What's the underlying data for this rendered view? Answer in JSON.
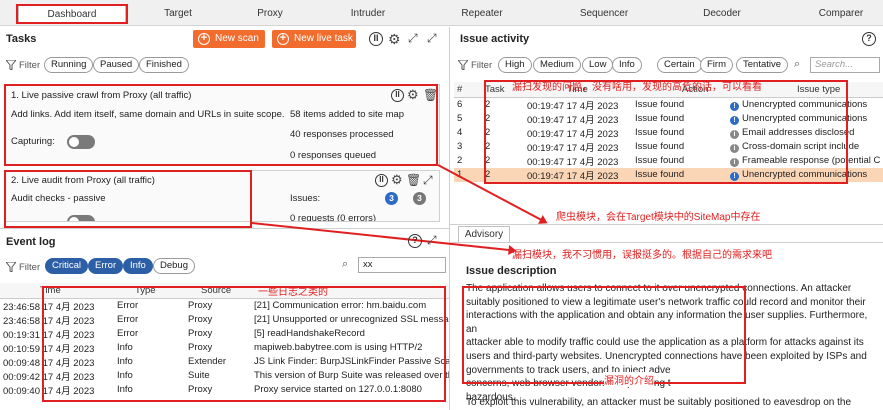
{
  "tabs": [
    "Dashboard",
    "Target",
    "Proxy",
    "Intruder",
    "Repeater",
    "Sequencer",
    "Decoder",
    "Comparer"
  ],
  "tasks": {
    "title": "Tasks",
    "new_scan": "New scan",
    "new_live_task": "New live task",
    "filter_label": "Filter",
    "filters": [
      "Running",
      "Paused",
      "Finished"
    ],
    "task1": {
      "title": "1. Live passive crawl from Proxy (all traffic)",
      "description": "Add links. Add item itself, same domain and URLs in suite scope.",
      "capturing_label": "Capturing:",
      "stat1": "58 items added to site map",
      "stat2": "40 responses processed",
      "stat3": "0 responses queued"
    },
    "task2": {
      "title": "2. Live audit from Proxy (all traffic)",
      "description": "Audit checks - passive",
      "issues_label": "Issues:",
      "issue_count_blue": "3",
      "issue_count_grey": "3",
      "requests": "0 requests (0 errors)"
    }
  },
  "issue_activity": {
    "title": "Issue activity",
    "filter_label": "Filter",
    "severity_filters": [
      "High",
      "Medium",
      "Low",
      "Info"
    ],
    "confidence_filters": [
      "Certain",
      "Firm",
      "Tentative"
    ],
    "search_placeholder": "Search...",
    "columns": [
      "#",
      "Task",
      "Time",
      "Action",
      "Issue type"
    ],
    "rows": [
      {
        "num": "6",
        "task": "2",
        "time": "00:19:47 17 4月 2023",
        "action": "Issue found",
        "issue": "Unencrypted communications",
        "sev": "!",
        "selected": false
      },
      {
        "num": "5",
        "task": "2",
        "time": "00:19:47 17 4月 2023",
        "action": "Issue found",
        "issue": "Unencrypted communications",
        "sev": "!",
        "selected": false
      },
      {
        "num": "4",
        "task": "2",
        "time": "00:19:47 17 4月 2023",
        "action": "Issue found",
        "issue": "Email addresses disclosed",
        "sev": "i",
        "selected": false
      },
      {
        "num": "3",
        "task": "2",
        "time": "00:19:47 17 4月 2023",
        "action": "Issue found",
        "issue": "Cross-domain script include",
        "sev": "i",
        "selected": false
      },
      {
        "num": "2",
        "task": "2",
        "time": "00:19:47 17 4月 2023",
        "action": "Issue found",
        "issue": "Frameable response (potential C",
        "sev": "i",
        "selected": false
      },
      {
        "num": "1",
        "task": "2",
        "time": "00:19:47 17 4月 2023",
        "action": "Issue found",
        "issue": "Unencrypted communications",
        "sev": "!",
        "selected": true
      }
    ]
  },
  "event_log": {
    "title": "Event log",
    "filter_label": "Filter",
    "filters": [
      "Critical",
      "Error",
      "Info",
      "Debug"
    ],
    "search_value": "xx",
    "columns": [
      "Time",
      "Type",
      "Source",
      "Message"
    ],
    "rows": [
      {
        "time": "23:46:58 17 4月 2023",
        "type": "Error",
        "source": "Proxy",
        "message": "[21]  Communication error: hm.baidu.com"
      },
      {
        "time": "23:46:58 17 4月 2023",
        "type": "Error",
        "source": "Proxy",
        "message": "[21]  Unsupported or unrecognized SSL messag"
      },
      {
        "time": "00:19:31 17 4月 2023",
        "type": "Error",
        "source": "Proxy",
        "message": "[5]  readHandshakeRecord"
      },
      {
        "time": "00:10:59 17 4月 2023",
        "type": "Info",
        "source": "Proxy",
        "message": "mapiweb.babytree.com is using HTTP/2"
      },
      {
        "time": "00:09:48 17 4月 2023",
        "type": "Info",
        "source": "Extender",
        "message": "JS Link Finder: BurpJSLinkFinder Passive Scanne"
      },
      {
        "time": "00:09:42 17 4月 2023",
        "type": "Info",
        "source": "Suite",
        "message": "This version of Burp Suite was released over th"
      },
      {
        "time": "00:09:40 17 4月 2023",
        "type": "Info",
        "source": "Proxy",
        "message": "Proxy service started on 127.0.0.1:8080"
      }
    ]
  },
  "advisory": {
    "tab": "Advisory",
    "heading": "Issue description",
    "lines": [
      "The application allows users to connect to it over unencrypted connections. An attacker",
      "suitably positioned to view a legitimate user's network traffic could record and monitor their",
      "interactions with the application and obtain any information the user supplies. Furthermore, an",
      "attacker able to modify traffic could use the application as a platform for attacks against its",
      "users and third-party websites. Unencrypted connections have been exploited by ISPs and",
      "governments to track users, and to inject adve",
      "concerns, web browser vendors are planning t",
      "hazardous."
    ],
    "last_line": "To exploit this vulnerability, an attacker must be suitably positioned to eavesdrop on the"
  },
  "annotations": {
    "issue_note": "漏扫发现的问题，没有啥用，发现的高危的话，可以看看",
    "crawler_note": "爬虫模块，会在Target模块中的SiteMap中存在",
    "scanner_note": "漏扫模块，我不习惯用，误报挺多的。根据自己的需求来吧",
    "log_note": "一些日志之类的",
    "vuln_note": "漏洞的介绍"
  },
  "colors": {
    "accent": "#f26c2e",
    "filter_on": "#2d5fa6",
    "annotation": "#e02020",
    "selected_row": "#fbd6b6"
  }
}
